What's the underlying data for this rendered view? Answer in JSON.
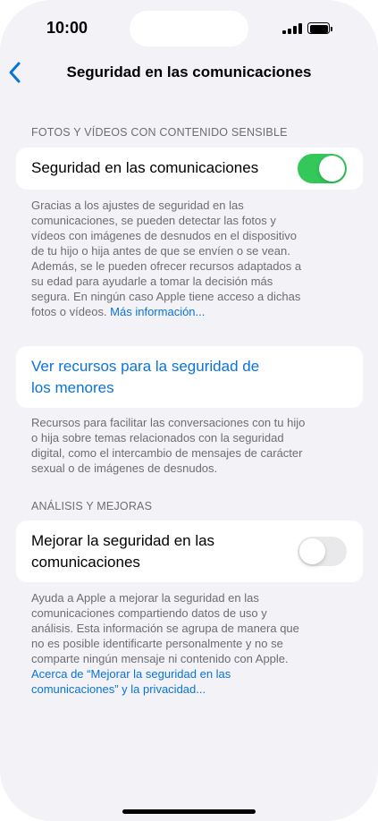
{
  "status_bar": {
    "time": "10:00"
  },
  "nav": {
    "title": "Seguridad en las comunicaciones"
  },
  "sections": {
    "fotos": {
      "header": "FOTOS Y VÍDEOS CON CONTENIDO SENSIBLE",
      "toggle_label": "Seguridad en las comunicaciones",
      "toggle_on": true,
      "footer_lines": [
        "Gracias a los ajustes de seguridad en las",
        "comunicaciones, se pueden detectar las fotos y",
        "vídeos con imágenes de desnudos en el dispositivo",
        "de tu hijo o hija antes de que se envíen o se vean.",
        "Además, se le pueden ofrecer recursos adaptados a",
        "su edad para ayudarle a tomar la decisión más",
        "segura. En ningún caso Apple tiene acceso a dichas"
      ],
      "footer_last_text": "fotos o vídeos. ",
      "footer_link": "Más información..."
    },
    "recursos": {
      "link_line1": "Ver recursos para la seguridad de",
      "link_line2": "los menores",
      "footer_lines": [
        "Recursos para facilitar las conversaciones con tu hijo",
        "o hija sobre temas relacionados con la seguridad",
        "digital, como el intercambio de mensajes de carácter",
        "sexual o de imágenes de desnudos."
      ]
    },
    "analisis": {
      "header": "ANÁLISIS Y MEJORAS",
      "toggle_label_line1": "Mejorar la seguridad en las",
      "toggle_label_line2": "comunicaciones",
      "toggle_on": false,
      "footer_lines": [
        "Ayuda a Apple a mejorar la seguridad en las",
        "comunicaciones compartiendo datos de uso y",
        "análisis. Esta información se agrupa de manera que",
        "no es posible identificarte personalmente y no se",
        "comparte ningún mensaje ni contenido con Apple."
      ],
      "footer_link_line1": "Acerca de “Mejorar la seguridad en las",
      "footer_link_line2": "comunicaciones” y la privacidad..."
    }
  },
  "colors": {
    "accent": "#0a73d9",
    "toggle_on": "#34c759",
    "toggle_off": "#e9e9eb",
    "background": "#f2f2f7"
  }
}
